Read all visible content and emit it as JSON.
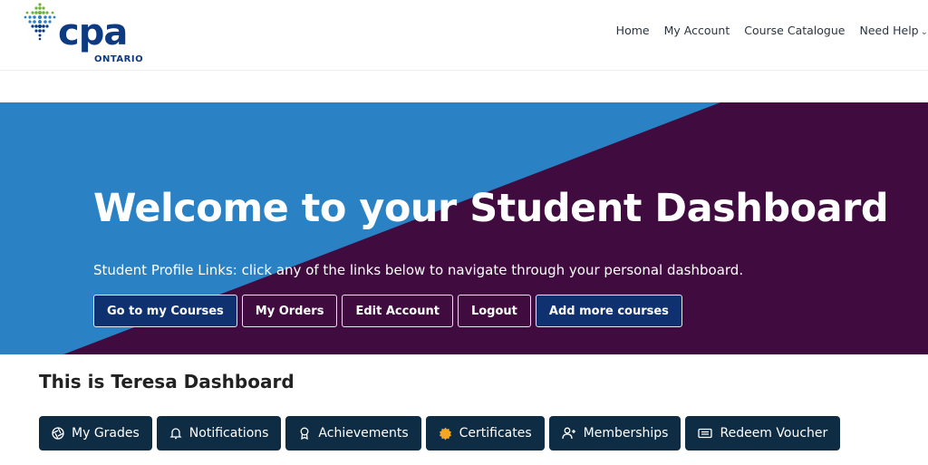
{
  "brand": {
    "logo_text": "cpa",
    "logo_sub": "ONTARIO",
    "colors": {
      "primary": "#0d3a80",
      "hero_blue": "#2a82c4",
      "hero_purple": "#400b3f",
      "tab_bg": "#0f2c45",
      "accent_green": "#6db33f"
    }
  },
  "nav": {
    "items": [
      {
        "label": "Home"
      },
      {
        "label": "My Account"
      },
      {
        "label": "Course Catalogue"
      },
      {
        "label": "Need Help"
      }
    ],
    "dropdown_icon": "chevron-down-icon"
  },
  "hero": {
    "title": "Welcome to your Student Dashboard",
    "subtitle": "Student Profile Links: click any of the links below to navigate through your personal dashboard.",
    "buttons": [
      {
        "label": "Go to my Courses"
      },
      {
        "label": "My Orders"
      },
      {
        "label": "Edit Account"
      },
      {
        "label": "Logout"
      },
      {
        "label": "Add more courses"
      }
    ]
  },
  "dashboard": {
    "title": "This is Teresa Dashboard",
    "tabs": [
      {
        "label": "My Grades",
        "icon": "aperture-icon"
      },
      {
        "label": "Notifications",
        "icon": "bell-icon"
      },
      {
        "label": "Achievements",
        "icon": "award-icon"
      },
      {
        "label": "Certificates",
        "icon": "seal-icon"
      },
      {
        "label": "Memberships",
        "icon": "user-plus-icon"
      },
      {
        "label": "Redeem Voucher",
        "icon": "ticket-icon"
      }
    ]
  }
}
